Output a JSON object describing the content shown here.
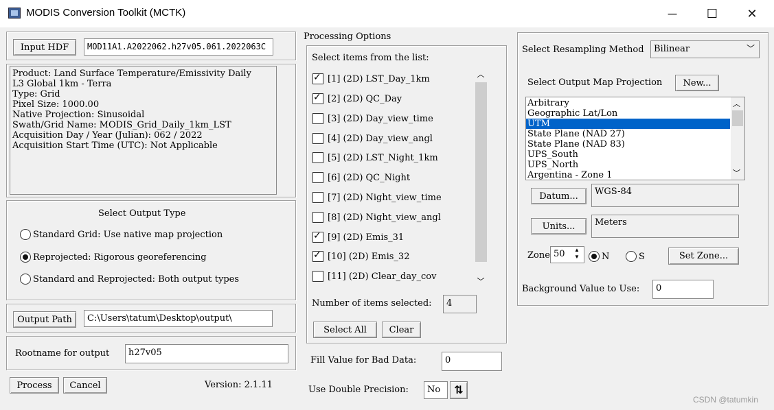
{
  "window": {
    "title": "MODIS Conversion Toolkit (MCTK)",
    "minimize_glyph": "─",
    "maximize_glyph": "☐",
    "close_glyph": "✕"
  },
  "input": {
    "button_label": "Input HDF",
    "file_value": "MOD11A1.A2022062.h27v05.061.2022063C",
    "metadata_lines": [
      "Product: Land Surface Temperature/Emissivity Daily",
      "L3 Global 1km - Terra",
      "Type: Grid",
      "Pixel Size: 1000.00",
      "Native Projection: Sinusoidal",
      "Swath/Grid Name: MODIS_Grid_Daily_1km_LST",
      "Acquisition Day / Year (Julian): 062 / 2022",
      "Acquisition Start Time (UTC): Not Applicable"
    ]
  },
  "output_type": {
    "title": "Select Output Type",
    "options": [
      {
        "label": "Standard Grid: Use native map projection",
        "selected": false
      },
      {
        "label": "Reprojected: Rigorous georeferencing",
        "selected": true
      },
      {
        "label": "Standard and Reprojected: Both output types",
        "selected": false
      }
    ]
  },
  "output_path": {
    "button_label": "Output Path",
    "value": "C:\\Users\\tatum\\Desktop\\output\\"
  },
  "rootname": {
    "label": "Rootname for output",
    "value": "h27v05"
  },
  "actions": {
    "process_label": "Process",
    "cancel_label": "Cancel",
    "version_text": "Version: 2.1.11"
  },
  "processing": {
    "title": "Processing Options",
    "list_label": "Select items from the list:",
    "items": [
      {
        "label": "[1] (2D) LST_Day_1km",
        "checked": true
      },
      {
        "label": "[2] (2D) QC_Day",
        "checked": true
      },
      {
        "label": "[3] (2D) Day_view_time",
        "checked": false
      },
      {
        "label": "[4] (2D) Day_view_angl",
        "checked": false
      },
      {
        "label": "[5] (2D) LST_Night_1km",
        "checked": false
      },
      {
        "label": "[6] (2D) QC_Night",
        "checked": false
      },
      {
        "label": "[7] (2D) Night_view_time",
        "checked": false
      },
      {
        "label": "[8] (2D) Night_view_angl",
        "checked": false
      },
      {
        "label": "[9] (2D) Emis_31",
        "checked": true
      },
      {
        "label": "[10] (2D) Emis_32",
        "checked": true
      },
      {
        "label": "[11] (2D) Clear_day_cov",
        "checked": false
      }
    ],
    "count_label": "Number of items selected:",
    "count_value": "4",
    "select_all_label": "Select All",
    "clear_label": "Clear",
    "fill_label": "Fill Value for Bad Data:",
    "fill_value": "0",
    "double_label": "Use Double Precision:",
    "double_value": "No",
    "double_toggle_glyph": "⇅"
  },
  "resampling": {
    "label": "Select Resampling Method",
    "value": "Bilinear",
    "projection_label": "Select Output Map Projection",
    "new_label": "New...",
    "projections": [
      {
        "label": "Arbitrary",
        "selected": false
      },
      {
        "label": "Geographic Lat/Lon",
        "selected": false
      },
      {
        "label": "UTM",
        "selected": true
      },
      {
        "label": "State Plane (NAD 27)",
        "selected": false
      },
      {
        "label": "State Plane (NAD 83)",
        "selected": false
      },
      {
        "label": "UPS_South",
        "selected": false
      },
      {
        "label": "UPS_North",
        "selected": false
      },
      {
        "label": "Argentina - Zone 1",
        "selected": false
      }
    ],
    "datum_label": "Datum...",
    "datum_value": "WGS-84",
    "units_label": "Units...",
    "units_value": "Meters",
    "zone_label": "Zone",
    "zone_value": "50",
    "hemisphere_n": "N",
    "hemisphere_s": "S",
    "hemisphere_selected": "N",
    "set_zone_label": "Set Zone...",
    "background_label": "Background Value to Use:",
    "background_value": "0"
  },
  "watermark": "CSDN @tatumkin"
}
